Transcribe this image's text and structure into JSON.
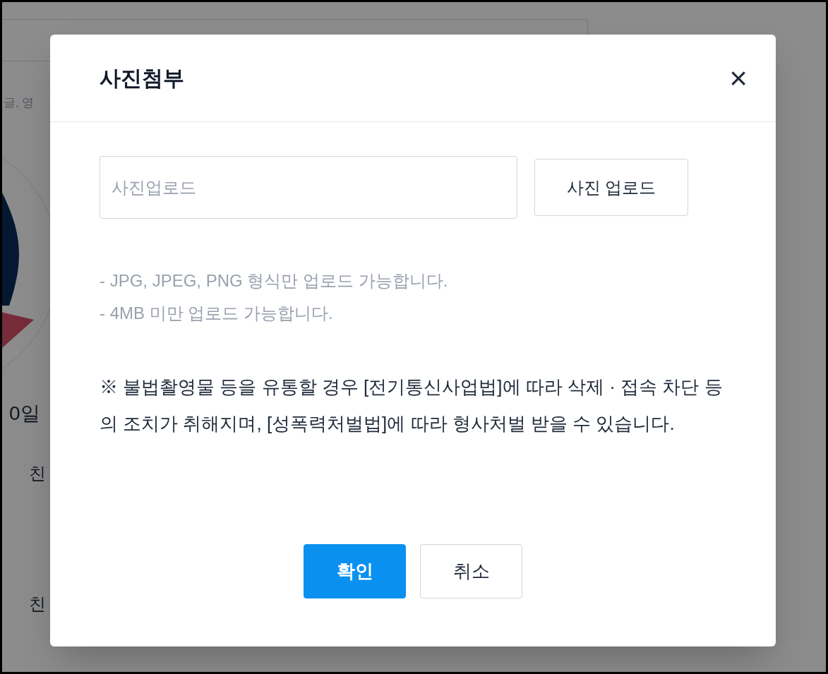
{
  "background": {
    "field_hint": "글, 영",
    "date_text": "0일",
    "list_items": [
      "친",
      "친"
    ]
  },
  "dialog": {
    "title": "사진첨부",
    "close": "×",
    "upload": {
      "placeholder": "사진업로드",
      "button": "사진 업로드"
    },
    "notes": [
      "- JPG, JPEG, PNG 형식만 업로드 가능합니다.",
      "- 4MB 미만 업로드 가능합니다."
    ],
    "warning": "※ 불법촬영물 등을 유통할 경우 [전기통신사업법]에 따라 삭제 · 접속 차단 등의 조치가 취해지며, [성폭력처벌법]에 따라 형사처벌 받을 수 있습니다.",
    "buttons": [
      {
        "label": "확인",
        "kind": "primary"
      },
      {
        "label": "취소",
        "kind": "secondary"
      }
    ]
  }
}
